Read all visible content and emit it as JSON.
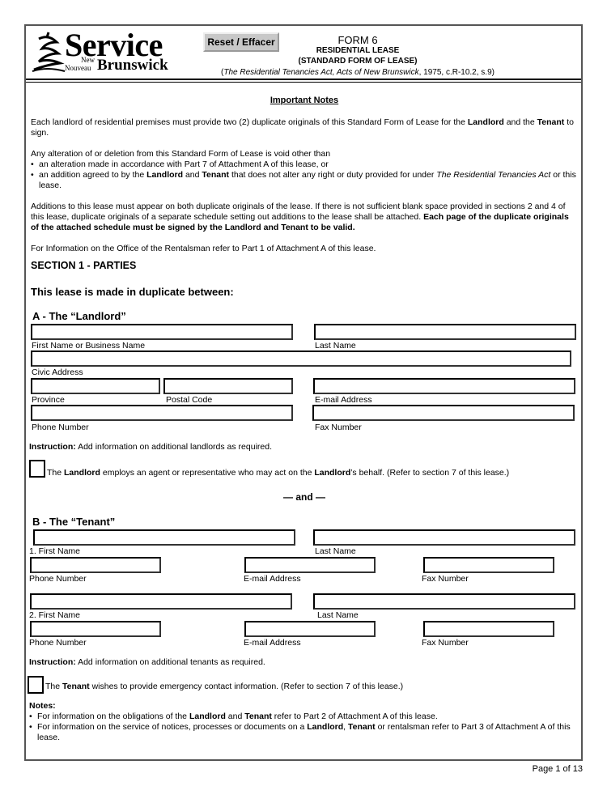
{
  "header": {
    "logo": {
      "service": "Service",
      "new": "New",
      "nouveau": "Nouveau",
      "brunswick": "Brunswick"
    },
    "reset_button": "Reset / Effacer",
    "form_number": "FORM 6",
    "form_name": "RESIDENTIAL LEASE",
    "form_subtitle": "(STANDARD FORM OF LEASE)",
    "act_open": "(",
    "act_italic": "The Residential Tenancies Act, Acts of New Brunswick",
    "act_rest": ", 1975, c.R-10.2, s.9)"
  },
  "notes": {
    "heading": "Important Notes",
    "p1": [
      "Each landlord of residential premises must provide two (2) duplicate originals of this Standard Form of Lease for the ",
      "Landlord",
      " and the ",
      "Tenant",
      " to sign."
    ],
    "p2_intro": "Any alteration of or deletion from this Standard Form of Lease is void other than",
    "p2_bullet1": "an alteration made in accordance with Part 7 of Attachment A of this lease, or",
    "p2_bullet2": [
      "an addition agreed to by the ",
      "Landlord",
      " and ",
      "Tenant",
      " that does not alter any right or duty provided for under ",
      "The Residential Tenancies Act",
      " or this lease."
    ],
    "p3_normal": "Additions to this lease must appear on both duplicate originals of the lease.  If there is not sufficient blank space provided in sections 2 and 4 of this lease, duplicate originals of a separate schedule setting out additions to the lease shall be attached. ",
    "p3_bold": "Each page of the duplicate originals of the attached schedule must be signed by the Landlord and Tenant to be valid.",
    "p4": "For Information on the Office of the Rentalsman refer to Part 1 of Attachment A of this lease."
  },
  "section1": {
    "title": "SECTION 1 - PARTIES",
    "intro": "This lease is made in duplicate between:",
    "landlord": {
      "heading": "A - The “Landlord”",
      "labels": {
        "first_name": "First Name or Business Name",
        "last_name": "Last Name",
        "civic_address": "Civic Address",
        "province": "Province",
        "postal_code": "Postal Code",
        "email": "E-mail Address",
        "phone": "Phone Number",
        "fax": "Fax Number"
      },
      "values": {
        "first_name": "",
        "last_name": "",
        "civic_address": "",
        "province": "",
        "postal_code": "",
        "email": "",
        "phone": "",
        "fax": ""
      },
      "instruction_bold": "Instruction:",
      "instruction": " Add information on additional landlords as required.",
      "agent_checkbox": [
        "The ",
        "Landlord",
        " employs an agent or representative who may act on the ",
        "Landlord",
        "’s behalf. (Refer to section 7 of this lease.)"
      ],
      "agent_checked": false
    },
    "and": "— and —",
    "tenant": {
      "heading": "B - The “Tenant”",
      "tenants": [
        {
          "first_label": "1. First Name",
          "last_label": "Last Name",
          "phone_label": "Phone Number",
          "email_label": "E-mail Address",
          "fax_label": "Fax Number",
          "first": "",
          "last": "",
          "phone": "",
          "email": "",
          "fax": ""
        },
        {
          "first_label": "2. First Name",
          "last_label": "Last Name",
          "phone_label": "Phone Number",
          "email_label": "E-mail Address",
          "fax_label": "Fax Number",
          "first": "",
          "last": "",
          "phone": "",
          "email": "",
          "fax": ""
        }
      ],
      "instruction_bold": "Instruction:",
      "instruction": " Add information on additional tenants as required.",
      "emergency_checkbox": [
        "The ",
        "Tenant",
        " wishes to provide emergency contact information. (Refer to section 7 of this lease.)"
      ],
      "emergency_checked": false
    },
    "notes_heading": "Notes:",
    "note1": [
      "For information on the obligations of the ",
      "Landlord",
      " and ",
      "Tenant",
      " refer to Part 2 of Attachment A of this lease."
    ],
    "note2": [
      "For information on the service of notices, processes or documents on a ",
      "Landlord",
      ", ",
      "Tenant",
      " or rentalsman refer to Part 3 of Attachment A of this lease."
    ]
  },
  "footer": {
    "page": "Page 1 of 13"
  }
}
